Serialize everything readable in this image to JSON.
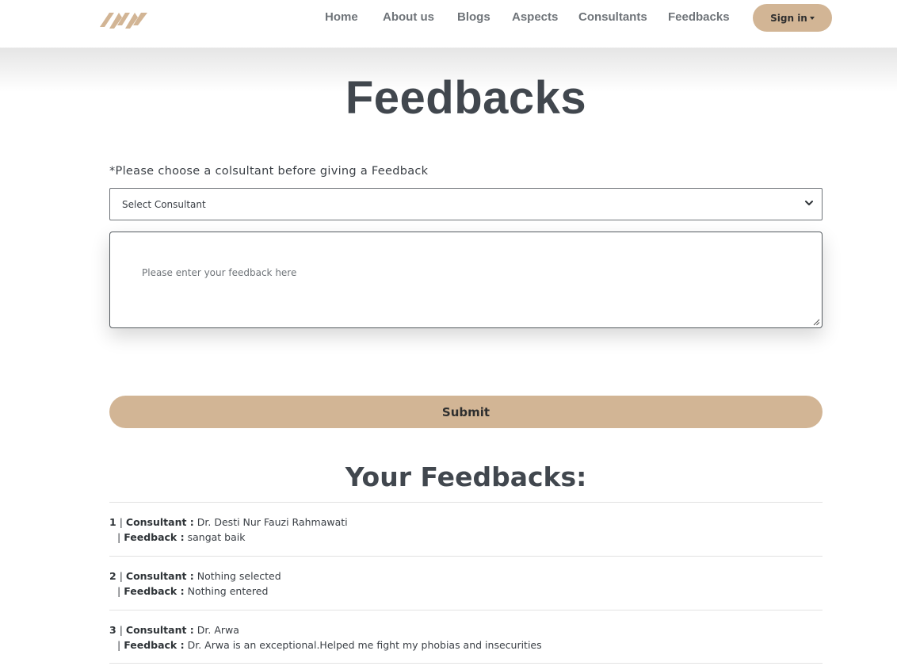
{
  "header": {
    "logo_icon": "brand-logo-icon",
    "nav": [
      "Home",
      "About us",
      "Blogs",
      "Aspects",
      "Consultants",
      "Feedbacks"
    ],
    "signin_label": "Sign in"
  },
  "colors": {
    "accent": "#d2b595",
    "title": "#41474e"
  },
  "page_title": "Feedbacks",
  "form": {
    "note": "*Please choose a colsultant before giving a Feedback",
    "select_value": "Select Consultant",
    "feedback_placeholder": "Please enter your feedback here",
    "submit_label": "Submit"
  },
  "list_title": "Your Feedbacks:",
  "labels": {
    "consultant": "Consultant :",
    "feedback": "Feedback :",
    "sep": "|"
  },
  "feedbacks": [
    {
      "num": "1",
      "consultant": "Dr. Desti Nur Fauzi Rahmawati",
      "feedback": "sangat baik"
    },
    {
      "num": "2",
      "consultant": "Nothing selected",
      "feedback": "Nothing entered"
    },
    {
      "num": "3",
      "consultant": "Dr. Arwa",
      "feedback": "Dr. Arwa is an exceptional.Helped me fight my phobias and insecurities"
    }
  ]
}
